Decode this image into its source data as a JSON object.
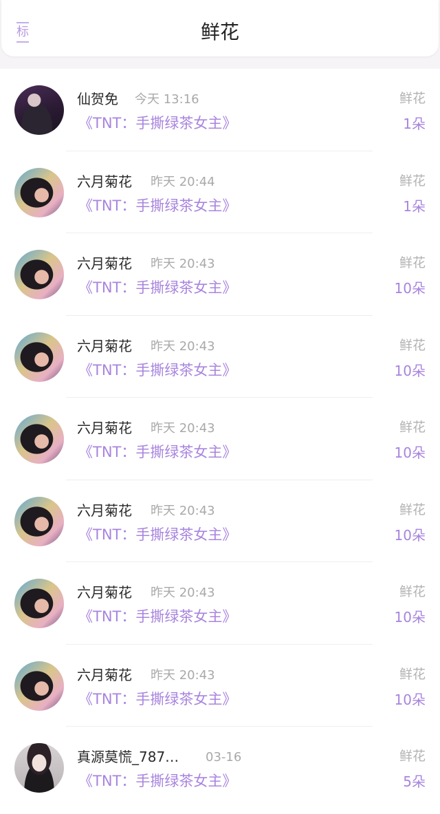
{
  "header": {
    "left_label": "标",
    "title": "鲜花"
  },
  "rows": [
    {
      "name": "仙贺免",
      "time": "今天 13:16",
      "book": "《TNT：手撕绿茶女主》",
      "gift_type": "鲜花",
      "gift_count": "1朵",
      "avatar": "avatar-boy-purple"
    },
    {
      "name": "六月菊花",
      "time": "昨天 20:44",
      "book": "《TNT：手撕绿茶女主》",
      "gift_type": "鲜花",
      "gift_count": "1朵",
      "avatar": "avatar-girl"
    },
    {
      "name": "六月菊花",
      "time": "昨天 20:43",
      "book": "《TNT：手撕绿茶女主》",
      "gift_type": "鲜花",
      "gift_count": "10朵",
      "avatar": "avatar-girl"
    },
    {
      "name": "六月菊花",
      "time": "昨天 20:43",
      "book": "《TNT：手撕绿茶女主》",
      "gift_type": "鲜花",
      "gift_count": "10朵",
      "avatar": "avatar-girl"
    },
    {
      "name": "六月菊花",
      "time": "昨天 20:43",
      "book": "《TNT：手撕绿茶女主》",
      "gift_type": "鲜花",
      "gift_count": "10朵",
      "avatar": "avatar-girl"
    },
    {
      "name": "六月菊花",
      "time": "昨天 20:43",
      "book": "《TNT：手撕绿茶女主》",
      "gift_type": "鲜花",
      "gift_count": "10朵",
      "avatar": "avatar-girl"
    },
    {
      "name": "六月菊花",
      "time": "昨天 20:43",
      "book": "《TNT：手撕绿茶女主》",
      "gift_type": "鲜花",
      "gift_count": "10朵",
      "avatar": "avatar-girl"
    },
    {
      "name": "六月菊花",
      "time": "昨天 20:43",
      "book": "《TNT：手撕绿茶女主》",
      "gift_type": "鲜花",
      "gift_count": "10朵",
      "avatar": "avatar-girl"
    },
    {
      "name": "真源莫慌_787…",
      "time": "03-16",
      "book": "《TNT：手撕绿茶女主》",
      "gift_type": "鲜花",
      "gift_count": "5朵",
      "avatar": "avatar-boy-white"
    }
  ]
}
